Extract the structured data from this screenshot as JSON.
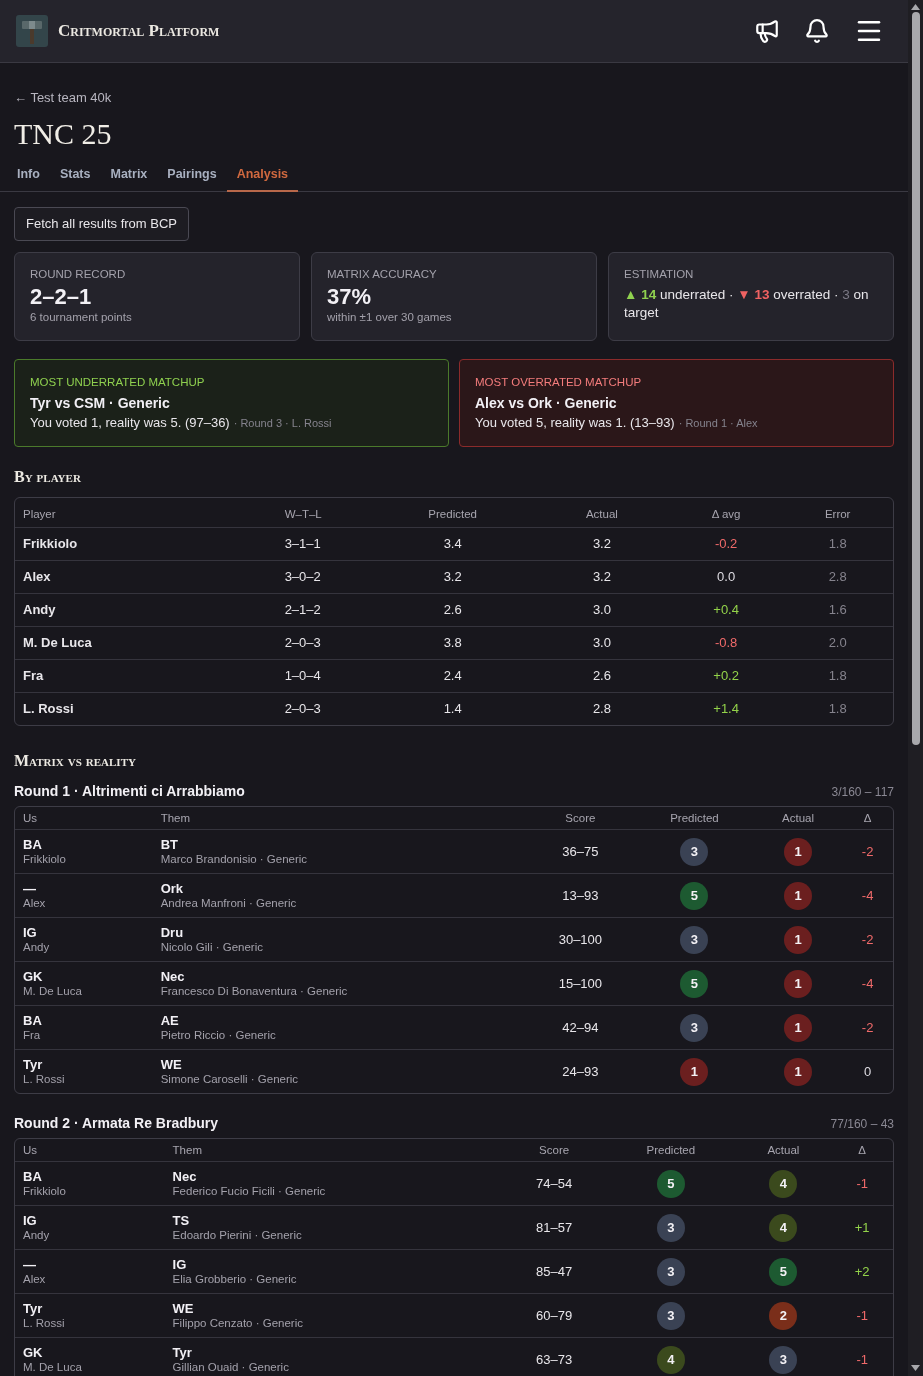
{
  "header": {
    "title": "Critmortal Platform"
  },
  "breadcrumb": {
    "label": "← Test team 40k"
  },
  "page_title": "TNC 25",
  "tabs": [
    {
      "label": "Info",
      "selected": false
    },
    {
      "label": "Stats",
      "selected": false
    },
    {
      "label": "Matrix",
      "selected": false
    },
    {
      "label": "Pairings",
      "selected": false
    },
    {
      "label": "Analysis",
      "selected": true
    }
  ],
  "fetch_button": {
    "label": "Fetch all results from BCP"
  },
  "summary_cards": [
    {
      "kind": "stat",
      "label": "ROUND RECORD",
      "value": "2–2–1",
      "note": "6 tournament points"
    },
    {
      "kind": "stat",
      "label": "MATRIX ACCURACY",
      "value": "37%",
      "note": "within ±1 over 30 games"
    },
    {
      "kind": "estimation",
      "label": "ESTIMATION",
      "items": [
        {
          "kind": "up",
          "symbol": "▲",
          "count": "14",
          "text": "underrated ·"
        },
        {
          "kind": "down",
          "symbol": "▼",
          "count": "13",
          "text": "overrated ·"
        },
        {
          "kind": "neutral",
          "count": "3",
          "text": "on target"
        }
      ]
    }
  ],
  "highlights": [
    {
      "kind": "underrated",
      "label": "MOST UNDERRATED MATCHUP",
      "title": "Tyr vs CSM · Generic",
      "detail": "You voted 1, reality was 5. (97–36)",
      "meta": "· Round 3 · L. Rossi"
    },
    {
      "kind": "overrated",
      "label": "MOST OVERRATED MATCHUP",
      "title": "Alex vs Ork · Generic",
      "detail": "You voted 5, reality was 1. (13–93)",
      "meta": "· Round 1 · Alex"
    }
  ],
  "by_player": {
    "title": "By player",
    "columns": [
      "Player",
      "W–T–L",
      "Predicted",
      "Actual",
      "Δ avg",
      "Error"
    ],
    "rows": [
      {
        "player": "Frikkiolo",
        "record": "3–1–1",
        "predicted": "3.4",
        "actual": "3.2",
        "delta": {
          "text": "-0.2",
          "kind": "negative"
        },
        "error": "1.8"
      },
      {
        "player": "Alex",
        "record": "3–0–2",
        "predicted": "3.2",
        "actual": "3.2",
        "delta": {
          "text": "0.0",
          "kind": "neutral"
        },
        "error": "2.8"
      },
      {
        "player": "Andy",
        "record": "2–1–2",
        "predicted": "2.6",
        "actual": "3.0",
        "delta": {
          "text": "+0.4",
          "kind": "positive"
        },
        "error": "1.6"
      },
      {
        "player": "M. De Luca",
        "record": "2–0–3",
        "predicted": "3.8",
        "actual": "3.0",
        "delta": {
          "text": "-0.8",
          "kind": "negative"
        },
        "error": "2.0"
      },
      {
        "player": "Fra",
        "record": "1–0–4",
        "predicted": "2.4",
        "actual": "2.6",
        "delta": {
          "text": "+0.2",
          "kind": "positive"
        },
        "error": "1.8"
      },
      {
        "player": "L. Rossi",
        "record": "2–0–3",
        "predicted": "1.4",
        "actual": "2.8",
        "delta": {
          "text": "+1.4",
          "kind": "positive"
        },
        "error": "1.8"
      }
    ]
  },
  "matrix": {
    "title": "Matrix vs reality",
    "rounds": [
      {
        "title": "Round 1 · Altrimenti ci Arrabbiamo",
        "total": "3/160 – 117",
        "columns": [
          "Us",
          "Them",
          "Score",
          "Predicted",
          "Actual",
          "Δ"
        ],
        "rows": [
          {
            "army": "BA",
            "player": "Frikkiolo",
            "opponent_army": "BT",
            "opponent": "Marco Brandonisio · Generic",
            "score": "36–75",
            "predicted": {
              "value": "3",
              "color": "#3a4254"
            },
            "actual": {
              "value": "1",
              "color": "#6b1f1f"
            },
            "delta": {
              "text": "-2",
              "kind": "negative"
            }
          },
          {
            "army": "—",
            "player": "Alex",
            "opponent_army": "Ork",
            "opponent": "Andrea Manfroni · Generic",
            "score": "13–93",
            "predicted": {
              "value": "5",
              "color": "#1d5a31"
            },
            "actual": {
              "value": "1",
              "color": "#6b1f1f"
            },
            "delta": {
              "text": "-4",
              "kind": "negative"
            }
          },
          {
            "army": "IG",
            "player": "Andy",
            "opponent_army": "Dru",
            "opponent": "Nicolo Gili · Generic",
            "score": "30–100",
            "predicted": {
              "value": "3",
              "color": "#3a4254"
            },
            "actual": {
              "value": "1",
              "color": "#6b1f1f"
            },
            "delta": {
              "text": "-2",
              "kind": "negative"
            }
          },
          {
            "army": "GK",
            "player": "M. De Luca",
            "opponent_army": "Nec",
            "opponent": "Francesco Di Bonaventura · Generic",
            "score": "15–100",
            "predicted": {
              "value": "5",
              "color": "#1d5a31"
            },
            "actual": {
              "value": "1",
              "color": "#6b1f1f"
            },
            "delta": {
              "text": "-4",
              "kind": "negative"
            }
          },
          {
            "army": "BA",
            "player": "Fra",
            "opponent_army": "AE",
            "opponent": "Pietro Riccio · Generic",
            "score": "42–94",
            "predicted": {
              "value": "3",
              "color": "#3a4254"
            },
            "actual": {
              "value": "1",
              "color": "#6b1f1f"
            },
            "delta": {
              "text": "-2",
              "kind": "negative"
            }
          },
          {
            "army": "Tyr",
            "player": "L. Rossi",
            "opponent_army": "WE",
            "opponent": "Simone Caroselli · Generic",
            "score": "24–93",
            "predicted": {
              "value": "1",
              "color": "#6b1f1f"
            },
            "actual": {
              "value": "1",
              "color": "#6b1f1f"
            },
            "delta": {
              "text": "0",
              "kind": "neutral"
            }
          }
        ]
      },
      {
        "title": "Round 2 · Armata Re Bradbury",
        "total": "77/160 – 43",
        "columns": [
          "Us",
          "Them",
          "Score",
          "Predicted",
          "Actual",
          "Δ"
        ],
        "rows": [
          {
            "army": "BA",
            "player": "Frikkiolo",
            "opponent_army": "Nec",
            "opponent": "Federico Fucio Ficili · Generic",
            "score": "74–54",
            "predicted": {
              "value": "5",
              "color": "#1d5a31"
            },
            "actual": {
              "value": "4",
              "color": "#3b4a1d"
            },
            "delta": {
              "text": "-1",
              "kind": "negative"
            }
          },
          {
            "army": "IG",
            "player": "Andy",
            "opponent_army": "TS",
            "opponent": "Edoardo Pierini · Generic",
            "score": "81–57",
            "predicted": {
              "value": "3",
              "color": "#3a4254"
            },
            "actual": {
              "value": "4",
              "color": "#3b4a1d"
            },
            "delta": {
              "text": "+1",
              "kind": "positive"
            }
          },
          {
            "army": "—",
            "player": "Alex",
            "opponent_army": "IG",
            "opponent": "Elia Grobberio · Generic",
            "score": "85–47",
            "predicted": {
              "value": "3",
              "color": "#3a4254"
            },
            "actual": {
              "value": "5",
              "color": "#1d5a31"
            },
            "delta": {
              "text": "+2",
              "kind": "positive"
            }
          },
          {
            "army": "Tyr",
            "player": "L. Rossi",
            "opponent_army": "WE",
            "opponent": "Filippo Cenzato · Generic",
            "score": "60–79",
            "predicted": {
              "value": "3",
              "color": "#3a4254"
            },
            "actual": {
              "value": "2",
              "color": "#7a2e1a"
            },
            "delta": {
              "text": "-1",
              "kind": "negative"
            }
          },
          {
            "army": "GK",
            "player": "M. De Luca",
            "opponent_army": "Tyr",
            "opponent": "Gillian Ouaid · Generic",
            "score": "63–73",
            "predicted": {
              "value": "4",
              "color": "#3b4a1d"
            },
            "actual": {
              "value": "3",
              "color": "#3a4254"
            },
            "delta": {
              "text": "-1",
              "kind": "negative"
            }
          }
        ]
      }
    ]
  }
}
